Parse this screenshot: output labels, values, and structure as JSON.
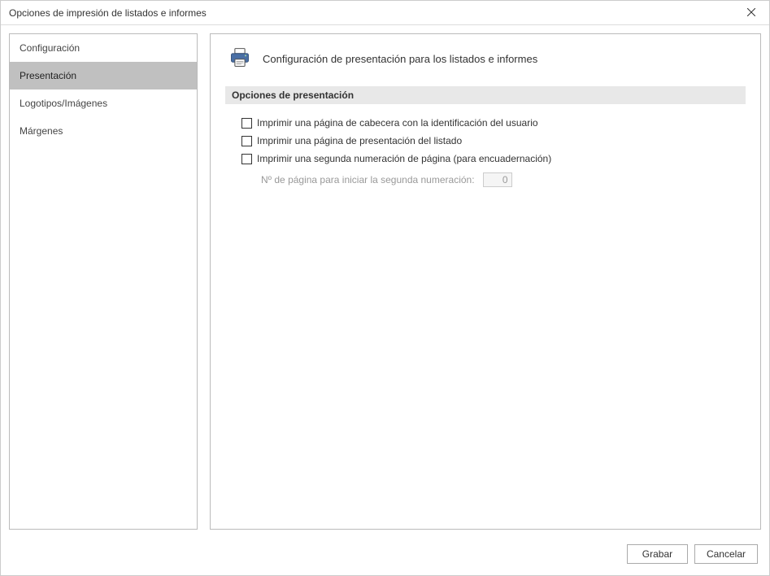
{
  "window": {
    "title": "Opciones de impresión de listados e informes"
  },
  "sidebar": {
    "items": [
      {
        "label": "Configuración",
        "selected": false
      },
      {
        "label": "Presentación",
        "selected": true
      },
      {
        "label": "Logotipos/Imágenes",
        "selected": false
      },
      {
        "label": "Márgenes",
        "selected": false
      }
    ]
  },
  "panel": {
    "title": "Configuración de presentación para los listados e informes",
    "section_title": "Opciones de presentación",
    "options": [
      {
        "label": "Imprimir una página de cabecera con la identificación del usuario",
        "checked": false
      },
      {
        "label": "Imprimir una página de presentación del listado",
        "checked": false
      },
      {
        "label": "Imprimir una segunda numeración de página (para encuadernación)",
        "checked": false
      }
    ],
    "start_page_label": "Nº de página para iniciar la segunda numeración:",
    "start_page_value": "0"
  },
  "footer": {
    "save": "Grabar",
    "cancel": "Cancelar"
  }
}
